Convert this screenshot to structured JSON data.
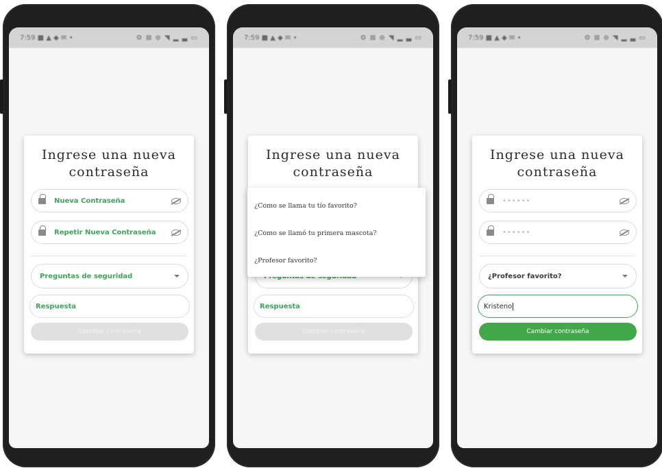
{
  "status_bar": {
    "time": "7:59",
    "left_icons": "■ ▲ ◆ ✉ •",
    "right_icons": "⚙ ⊠ ⊚ ◥ ▂ ▃ ▭"
  },
  "card": {
    "title_line1": "Ingrese una nueva",
    "title_line2": "contraseña",
    "new_password_placeholder": "Nueva Contraseña",
    "repeat_password_placeholder": "Repetir Nueva Contraseña",
    "masked_value": "••••••",
    "security_question_placeholder": "Preguntas de seguridad",
    "answer_placeholder": "Respuesta",
    "submit_label": "Cambiar contraseña"
  },
  "dropdown_options": [
    "¿Como se llama tu tío favorito?",
    "¿Como se llamó tu primera mascota?",
    "¿Profesor favorito?"
  ],
  "screen3": {
    "selected_question": "¿Profesor favorito?",
    "answer_value": "Kristeno"
  },
  "colors": {
    "accent_green": "#43a849",
    "label_green": "#3fa35c",
    "disabled_button": "#e0e0e0"
  }
}
